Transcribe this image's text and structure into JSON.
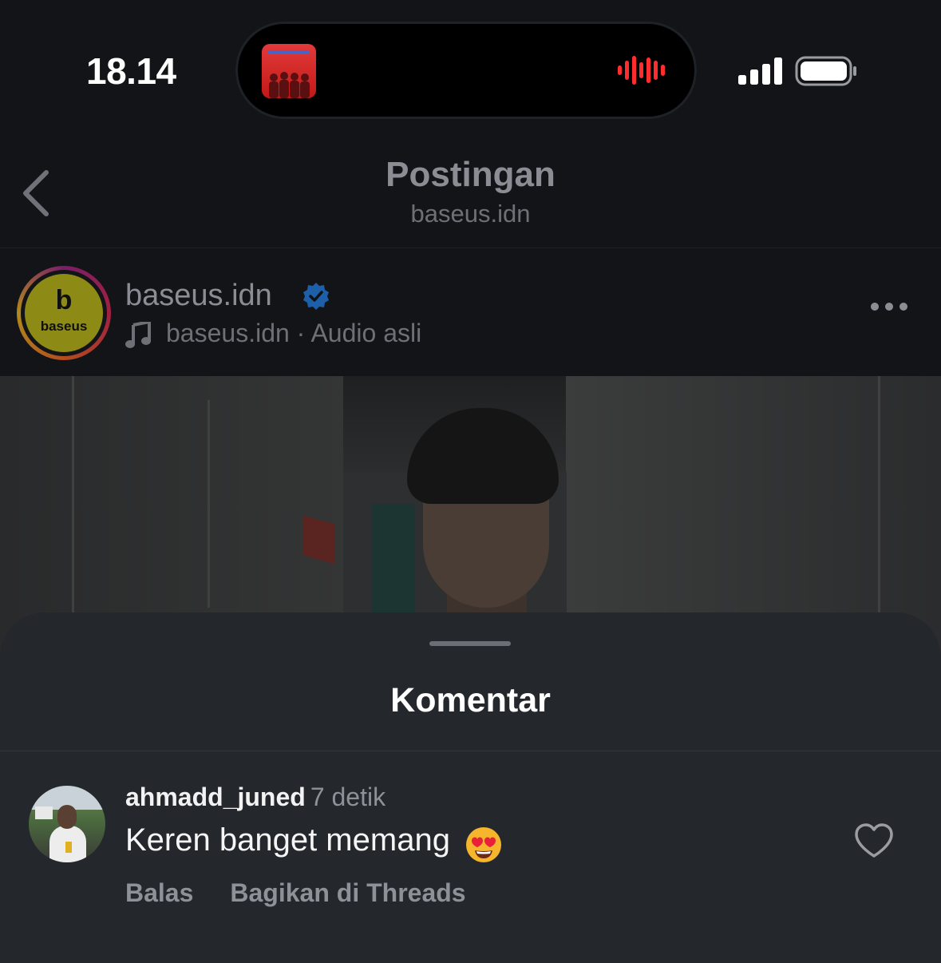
{
  "status_bar": {
    "time": "18.14"
  },
  "header": {
    "title": "Postingan",
    "subtitle": "baseus.idn",
    "back_icon": "chevron-left-icon"
  },
  "post": {
    "account_name": "baseus.idn",
    "avatar_letter": "b",
    "avatar_word": "baseus",
    "audio_text": "baseus.idn · Audio asli",
    "more_icon": "ellipsis-icon"
  },
  "comments_sheet": {
    "title": "Komentar",
    "comments": [
      {
        "username": "ahmadd_juned",
        "time": "7 detik",
        "text": "Keren banget memang",
        "emoji_icon": "heart-eyes-emoji-icon",
        "actions": [
          "Balas",
          "Bagikan di Threads"
        ]
      }
    ]
  },
  "colors": {
    "background": "#121417",
    "sheet": "#24272c",
    "verified_blue": "#1d6fd1",
    "waveform_red": "#ff2d2d"
  }
}
